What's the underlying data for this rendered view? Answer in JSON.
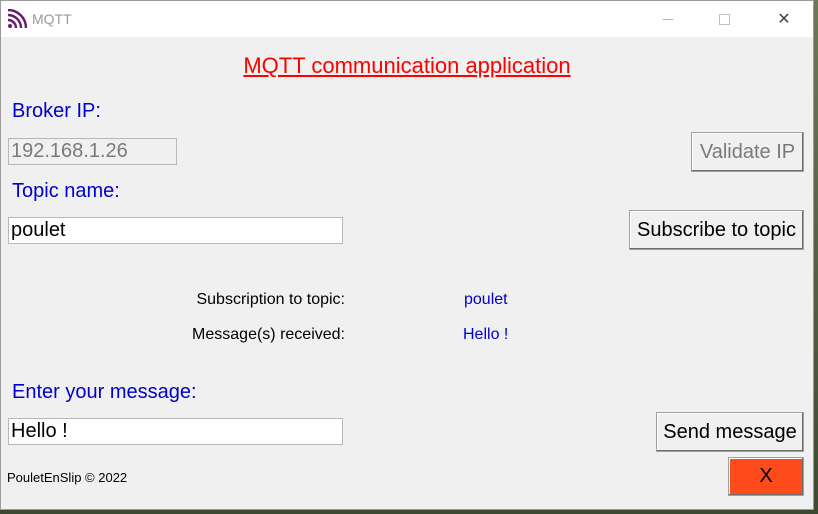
{
  "window": {
    "title": "MQTT",
    "minimize_label": "minimize",
    "maximize_label": "maximize",
    "close_glyph": "✕"
  },
  "app": {
    "heading": "MQTT communication application",
    "broker_label": "Broker IP:",
    "broker_ip_value": "192.168.1.26",
    "validate_button": "Validate IP",
    "topic_label": "Topic name:",
    "topic_value": "poulet",
    "subscribe_button": "Subscribe to topic",
    "subscription_label": "Subscription to topic:",
    "subscription_value": "poulet",
    "received_label": "Message(s) received:",
    "received_value": "Hello !",
    "message_label": "Enter your message:",
    "message_value": "Hello !",
    "send_button": "Send message",
    "exit_button": "X",
    "footer": "PouletEnSlip © 2022"
  },
  "colors": {
    "heading": "#ff0000",
    "label_blue": "#0000cc",
    "exit_button_bg": "#ff4a1c"
  },
  "icons": {
    "app_icon": "mqtt-wifi-signal-icon"
  }
}
